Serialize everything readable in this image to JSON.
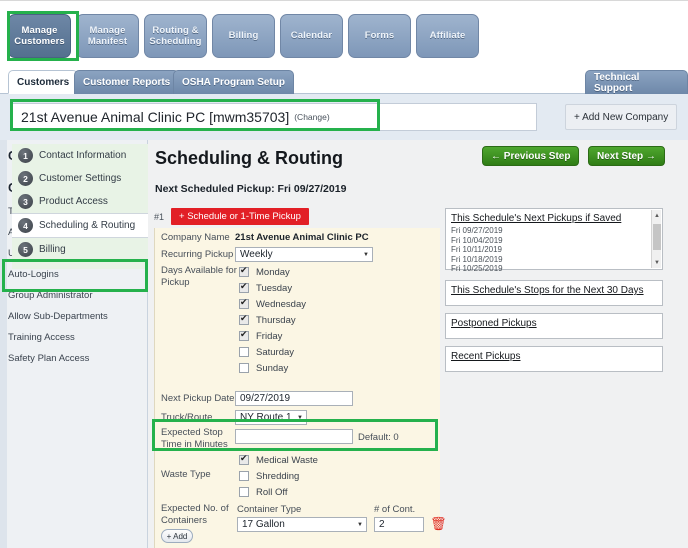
{
  "primary_tabs": [
    {
      "label_line1": "Manage",
      "label_line2": "Customers",
      "active": true
    },
    {
      "label_line1": "Manage",
      "label_line2": "Manifest",
      "active": false
    },
    {
      "label_line1": "Routing &",
      "label_line2": "Scheduling",
      "active": false
    },
    {
      "label_line1": "Billing",
      "label_line2": "",
      "active": false
    },
    {
      "label_line1": "Calendar",
      "label_line2": "",
      "active": false
    },
    {
      "label_line1": "Forms",
      "label_line2": "",
      "active": false
    },
    {
      "label_line1": "Affiliate",
      "label_line2": "",
      "active": false
    }
  ],
  "secondary_tabs": [
    {
      "label": "Customers",
      "active": true
    },
    {
      "label": "Customer Reports",
      "active": false
    },
    {
      "label": "OSHA Program Setup",
      "active": false
    }
  ],
  "technical_support": "Technical Support",
  "company": {
    "name": "21st Avenue Animal Clinic PC [mwm35703]",
    "change_link": "(Change)",
    "add_button": "+ Add New Company"
  },
  "sidebar": {
    "setup_title": "Customer Setup",
    "setup_items": [
      {
        "num": "1",
        "label": "Contact Information",
        "selected": false
      },
      {
        "num": "2",
        "label": "Customer Settings",
        "selected": false
      },
      {
        "num": "3",
        "label": "Product Access",
        "selected": false
      },
      {
        "num": "4",
        "label": "Scheduling & Routing",
        "selected": true
      },
      {
        "num": "5",
        "label": "Billing",
        "selected": false
      }
    ],
    "options_title": "Options",
    "options": [
      "Training Credits",
      "Administration Passwords",
      "Users",
      "Auto-Logins",
      "Group Administrator",
      "Allow Sub-Departments",
      "Training Access",
      "Safety Plan Access"
    ]
  },
  "main": {
    "title": "Scheduling & Routing",
    "next_scheduled_pickup": "Next Scheduled Pickup: Fri 09/27/2019",
    "previous_step": "← Previous Step",
    "next_step": "Next Step →",
    "row_index": "#1",
    "schedule_button": "+ Schedule or 1-Time Pickup",
    "form": {
      "company_name_label": "Company Name",
      "company_name_value": "21st Avenue Animal Clinic PC",
      "recurring_pickup_label": "Recurring Pickup",
      "recurring_pickup_value": "Weekly",
      "days_label_line1": "Days Available for",
      "days_label_line2": "Pickup",
      "days": [
        {
          "label": "Monday",
          "checked": true
        },
        {
          "label": "Tuesday",
          "checked": true
        },
        {
          "label": "Wednesday",
          "checked": true
        },
        {
          "label": "Thursday",
          "checked": true
        },
        {
          "label": "Friday",
          "checked": true
        },
        {
          "label": "Saturday",
          "checked": false
        },
        {
          "label": "Sunday",
          "checked": false
        }
      ],
      "next_pickup_date_label": "Next Pickup Date",
      "next_pickup_date_value": "09/27/2019",
      "truck_route_label": "Truck/Route",
      "truck_route_value": "NY Route 1",
      "stop_time_label_line1": "Expected Stop",
      "stop_time_label_line2": "Time in Minutes",
      "stop_time_value": "",
      "stop_time_default": "Default: 0",
      "waste_type_label": "Waste Type",
      "waste_types": [
        {
          "label": "Medical Waste",
          "checked": true
        },
        {
          "label": "Shredding",
          "checked": false
        },
        {
          "label": "Roll Off",
          "checked": false
        }
      ],
      "containers_label_line1": "Expected No. of",
      "containers_label_line2": "Containers",
      "add_button": "+ Add",
      "container_type_label": "Container Type",
      "container_type_value": "17 Gallon",
      "num_cont_label": "# of Cont.",
      "num_cont_value": "2",
      "delete_icon": "trash-icon"
    },
    "right_panel": {
      "next_pickups_link": "This Schedule's Next Pickups if Saved",
      "next_pickups_dates": [
        "Fri 09/27/2019",
        "Fri 10/04/2019",
        "Fri 10/11/2019",
        "Fri 10/18/2019",
        "Fri 10/25/2019"
      ],
      "stops_link": "This Schedule's Stops for the Next 30 Days",
      "postponed_link": "Postponed Pickups",
      "recent_link": "Recent Pickups"
    }
  },
  "annotation_color": "#25b14c"
}
